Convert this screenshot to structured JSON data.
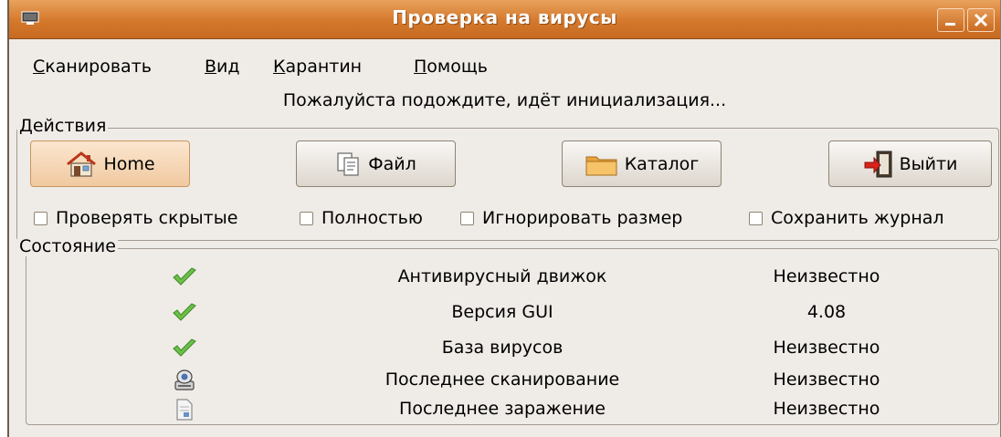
{
  "window": {
    "title": "Проверка на вирусы"
  },
  "menu": [
    {
      "label": "Сканировать",
      "accel": "С"
    },
    {
      "label": "Вид",
      "accel": "В"
    },
    {
      "label": "Карантин",
      "accel": "К"
    },
    {
      "label": "Помощь",
      "accel": "П"
    }
  ],
  "status_message": "Пожалуйста подождите, идёт инициализация...",
  "actions": {
    "label": "Действия",
    "buttons": {
      "home": "Home",
      "file": "Файл",
      "directory": "Каталог",
      "quit": "Выйти"
    },
    "checkboxes": [
      {
        "label": "Проверять скрытые",
        "checked": false
      },
      {
        "label": "Полностью",
        "checked": false
      },
      {
        "label": "Игнорировать размер",
        "checked": false
      },
      {
        "label": "Сохранить журнал",
        "checked": false
      }
    ]
  },
  "status": {
    "label": "Состояние",
    "rows": [
      {
        "icon": "check-icon",
        "name": "Антивирусный движок",
        "value": "Неизвестно"
      },
      {
        "icon": "check-icon",
        "name": "Версия GUI",
        "value": "4.08"
      },
      {
        "icon": "check-icon",
        "name": "База вирусов",
        "value": "Неизвестно"
      },
      {
        "icon": "scanner-icon",
        "name": "Последнее сканирование",
        "value": "Неизвестно"
      },
      {
        "icon": "document-icon",
        "name": "Последнее заражение",
        "value": "Неизвестно"
      }
    ]
  },
  "colors": {
    "titlebar": "#d4782c",
    "window_bg": "#efebe7",
    "check": "#5fb23a"
  }
}
